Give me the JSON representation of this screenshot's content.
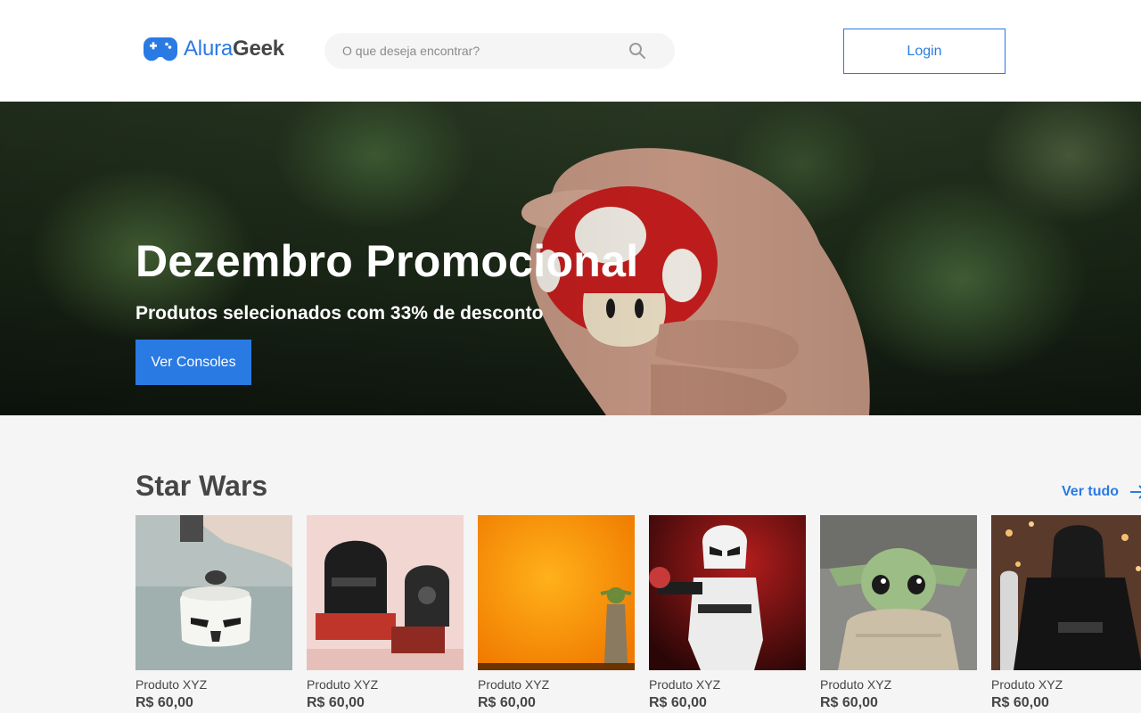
{
  "header": {
    "logo": {
      "part1": "Alura",
      "part2": "Geek"
    },
    "search": {
      "placeholder": "O que deseja encontrar?",
      "value": ""
    },
    "login_label": "Login"
  },
  "hero": {
    "title": "Dezembro Promocional",
    "subtitle": "Produtos selecionados com 33% de desconto",
    "button_label": "Ver Consoles"
  },
  "section": {
    "title": "Star Wars",
    "see_all_label": "Ver tudo",
    "products": [
      {
        "name": "Produto XYZ",
        "price": "R$ 60,00",
        "image": "stormtrooper-mug"
      },
      {
        "name": "Produto XYZ",
        "price": "R$ 60,00",
        "image": "lego-helmets"
      },
      {
        "name": "Produto XYZ",
        "price": "R$ 60,00",
        "image": "yoda-orange"
      },
      {
        "name": "Produto XYZ",
        "price": "R$ 60,00",
        "image": "stormtrooper-figure"
      },
      {
        "name": "Produto XYZ",
        "price": "R$ 60,00",
        "image": "baby-yoda"
      },
      {
        "name": "Produto XYZ",
        "price": "R$ 60,00",
        "image": "kylo-ren"
      }
    ]
  },
  "colors": {
    "accent": "#2a7ae4",
    "text": "#464646",
    "background": "#f5f5f5"
  }
}
